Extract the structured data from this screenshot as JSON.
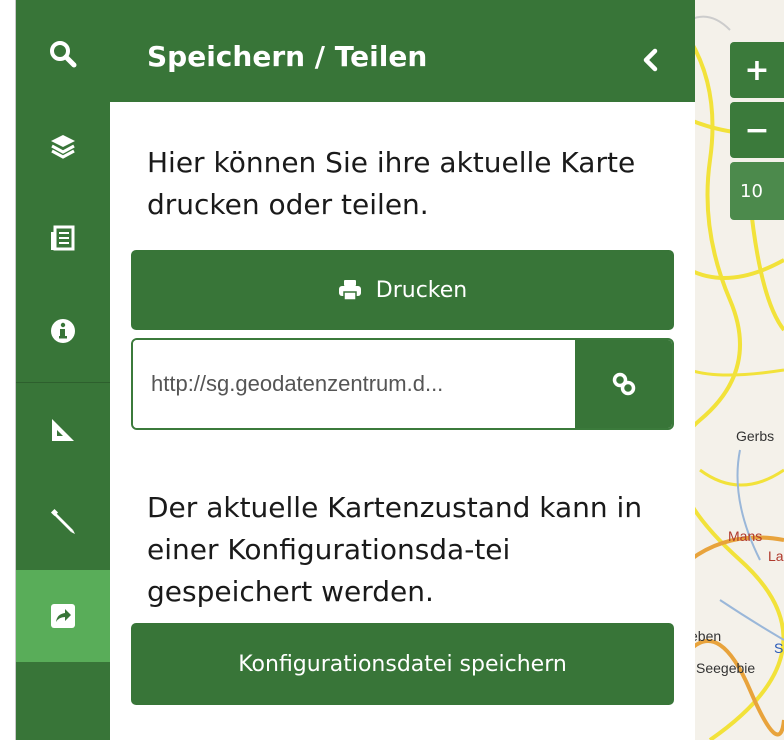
{
  "sidebar": {
    "items": [
      {
        "icon": "search-icon",
        "active": false
      },
      {
        "icon": "layers-icon",
        "active": false
      },
      {
        "icon": "legend-icon",
        "active": false
      },
      {
        "icon": "info-icon",
        "active": false
      },
      {
        "icon": "measure-icon",
        "active": false
      },
      {
        "icon": "draw-icon",
        "active": false
      },
      {
        "icon": "share-icon",
        "active": true
      }
    ]
  },
  "panel": {
    "title": "Speichern / Teilen",
    "intro": "Hier können Sie ihre aktuelle Karte drucken oder teilen.",
    "print_label": "Drucken",
    "url_value": "http://sg.geodatenzentrum.d...",
    "config_text": "Der aktuelle Kartenzustand kann in einer Konfigurationsda-tei gespeichert werden.",
    "save_config_label": "Konfigurationsdatei speichern"
  },
  "map": {
    "zoom_in_label": "+",
    "zoom_out_label": "−",
    "zoom_level": "10",
    "labels": [
      "Gerbs",
      "Mans",
      "La",
      "eben",
      "Seegebie",
      "S"
    ]
  },
  "colors": {
    "primary": "#387538",
    "active": "#59ad59",
    "map_background": "#f4f1ea",
    "road_yellow": "#f2e23a",
    "road_orange": "#e8a33c"
  }
}
